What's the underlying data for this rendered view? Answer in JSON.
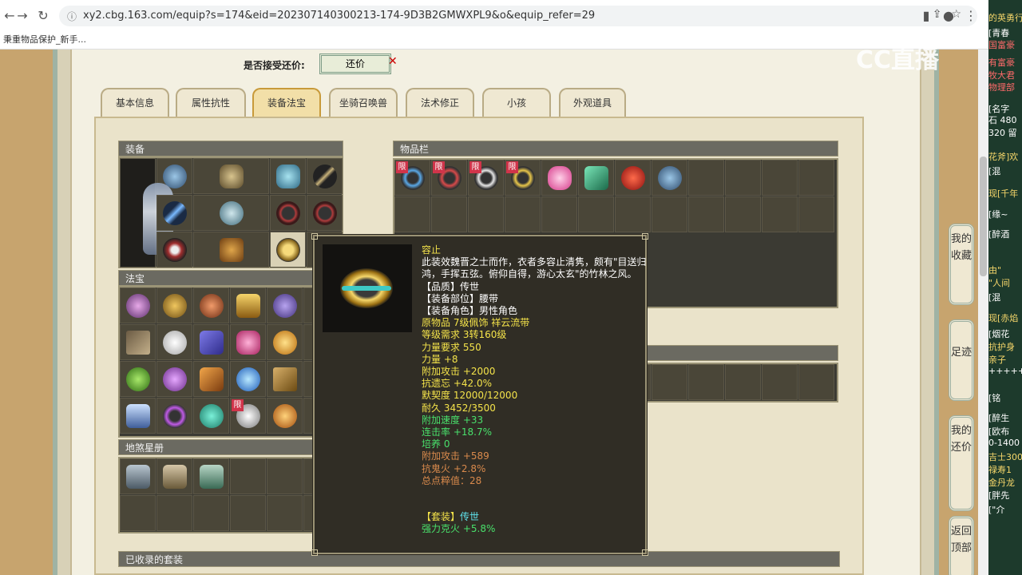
{
  "browser": {
    "url": "xy2.cbg.163.com/equip?s=174&eid=202307140300213-174-9D3B2GMWXPL9&o&equip_refer=29",
    "bookmark": "秉重物品保护_新手..."
  },
  "bargain": {
    "label": "是否接受还价:",
    "button": "还价"
  },
  "tabs": [
    "基本信息",
    "属性抗性",
    "装备法宝",
    "坐骑召唤兽",
    "法术修正",
    "小孩",
    "外观道具"
  ],
  "sections": {
    "equipment": "装备",
    "fabao": "法宝",
    "dishaxing": "地煞星册",
    "inventory": "物品栏",
    "collected_sets": "已收录的套装"
  },
  "limit_badge": "限",
  "tooltip": {
    "name": "容止",
    "description": "此装效魏晋之士而作，衣者多容止清隽，颇有\"目送归鸿，手挥五弦。俯仰自得，游心太玄\"的竹林之风。",
    "quality": "【品质】传世",
    "slot": "【装备部位】腰带",
    "role": "【装备角色】男性角色",
    "origin": "原物品 7级佩饰 祥云流带",
    "level_req": "等级需求 3转160级",
    "strength_req": "力量要求 550",
    "strength": "力量 +8",
    "attack": "附加攻击 +2000",
    "anti_forget": "抗遗忘 +42.0%",
    "tacit": "默契度 12000/12000",
    "durability": "耐久 3452/3500",
    "speed": "附加速度 +33",
    "combo": "连击率 +18.7%",
    "cultivate": "培养 0",
    "extra_attack": "附加攻击 +589",
    "anti_ghostfire": "抗鬼火 +2.8%",
    "total_points": "总点粹值：28",
    "set_label": "【套装】",
    "set_name": "传世",
    "set_bonus": "强力克火 +5.8%"
  },
  "side_buttons": {
    "favorites": "我的收藏",
    "footprints": "足迹",
    "my_bargains": "我的还价",
    "back_top": "返回顶部"
  },
  "overlay": {
    "logo": "CC直播",
    "chat_lines": [
      "的英勇行",
      "[青春",
      "国富豪",
      "有富豪",
      "牧大君",
      "物理部",
      "[名字",
      "石 480",
      "320 留",
      "花斧]欢",
      "[混",
      "现[千年",
      "[缘~",
      "[醉酒",
      "由\"",
      "\"人间",
      "[混",
      "现[赤焰",
      "[烟花",
      "抗护身",
      "亲子",
      "+++++",
      "[铭",
      "[醉生",
      "[欧布",
      "0-1400",
      "吉士300",
      "禄寿1",
      "金丹龙",
      "[胖先",
      "[\"介"
    ]
  }
}
